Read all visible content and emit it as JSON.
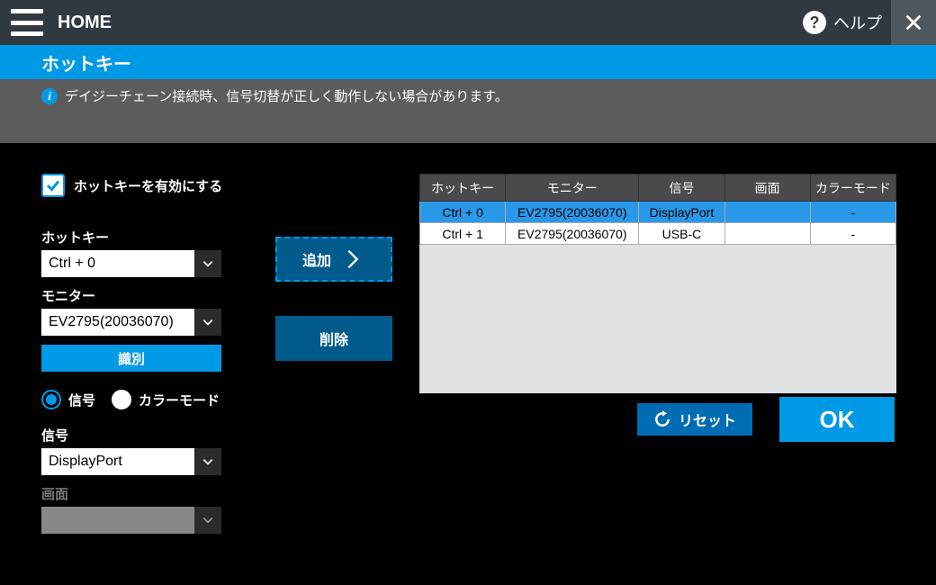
{
  "topbar": {
    "home": "HOME",
    "help": "ヘルプ"
  },
  "title": "ホットキー",
  "info_text": "デイジーチェーン接続時、信号切替が正しく動作しない場合があります。",
  "enable_label": "ホットキーを有効にする",
  "form": {
    "hotkey_label": "ホットキー",
    "hotkey_value": "Ctrl + 0",
    "monitor_label": "モニター",
    "monitor_value": "EV2795(20036070)",
    "identify": "識別",
    "radio_signal": "信号",
    "radio_colormode": "カラーモード",
    "signal_label": "信号",
    "signal_value": "DisplayPort",
    "screen_label": "画面",
    "screen_value": ""
  },
  "actions": {
    "add": "追加",
    "delete": "削除",
    "reset": "リセット",
    "ok": "OK"
  },
  "table": {
    "headers": [
      "ホットキー",
      "モニター",
      "信号",
      "画面",
      "カラーモード"
    ],
    "rows": [
      {
        "selected": true,
        "cells": [
          "Ctrl + 0",
          "EV2795(20036070)",
          "DisplayPort",
          "",
          "-"
        ]
      },
      {
        "selected": false,
        "cells": [
          "Ctrl + 1",
          "EV2795(20036070)",
          "USB-C",
          "",
          "-"
        ]
      }
    ]
  }
}
